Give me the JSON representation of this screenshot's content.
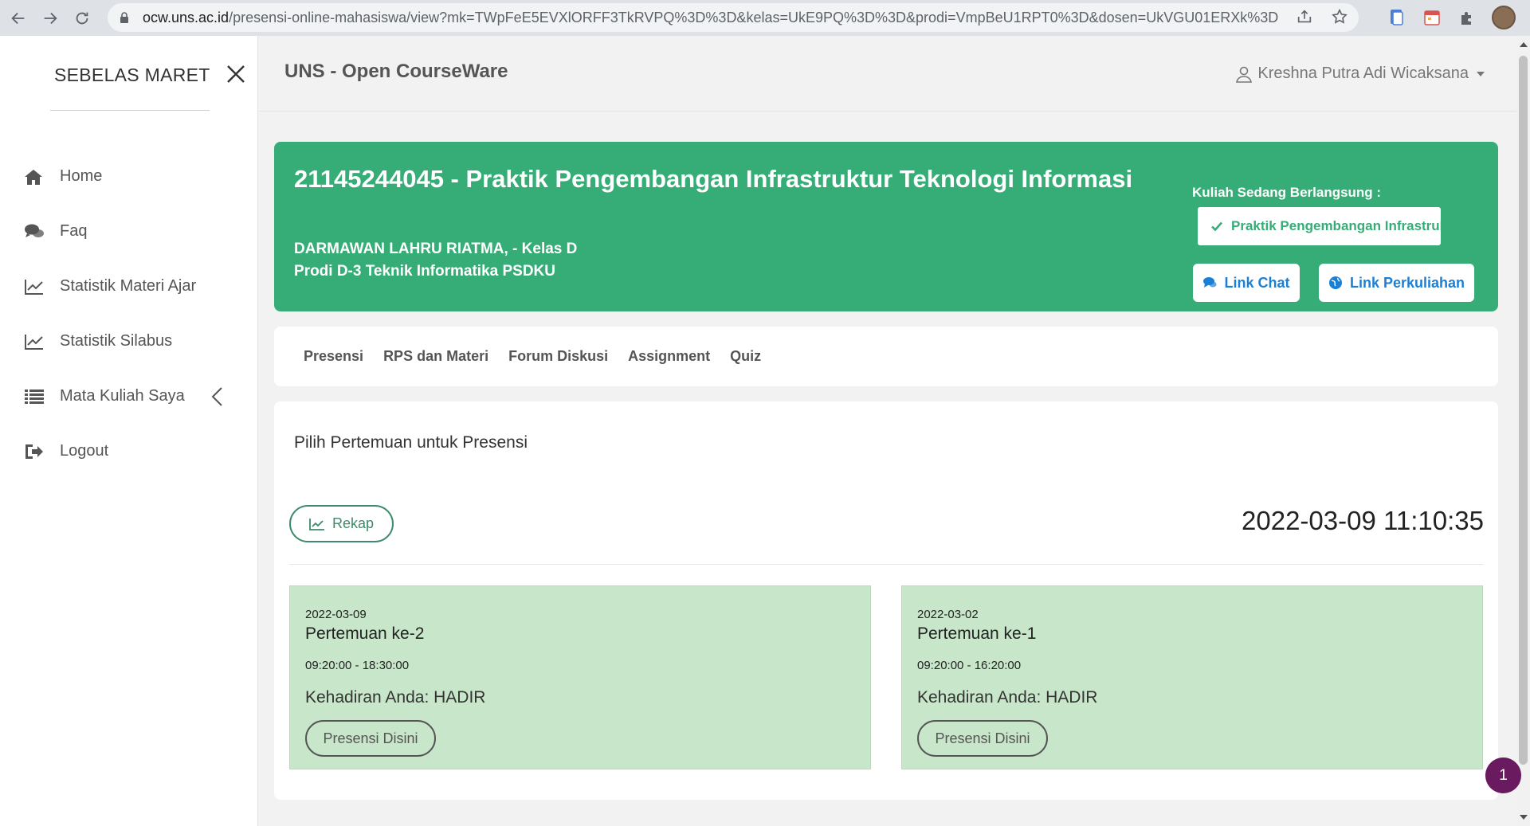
{
  "browser": {
    "url_host": "ocw.uns.ac.id",
    "url_path": "/presensi-online-mahasiswa/view?mk=TWpFeE5EVXlORFF3TkRVPQ%3D%3D&kelas=UkE9PQ%3D%3D&prodi=VmpBeU1RPT0%3D&dosen=UkVGU01ERXk%3D"
  },
  "sidebar": {
    "brand": "SEBELAS MARET",
    "items": [
      {
        "label": "Home",
        "icon": "home-icon"
      },
      {
        "label": "Faq",
        "icon": "chat-bubbles-icon"
      },
      {
        "label": "Statistik Materi Ajar",
        "icon": "line-chart-icon"
      },
      {
        "label": "Statistik Silabus",
        "icon": "line-chart-icon"
      },
      {
        "label": "Mata Kuliah Saya",
        "icon": "list-icon"
      },
      {
        "label": "Logout",
        "icon": "logout-icon"
      }
    ]
  },
  "header": {
    "app_title": "UNS - Open CourseWare",
    "user_name": "Kreshna Putra Adi Wicaksana"
  },
  "course": {
    "title": "21145244045 - Praktik Pengembangan Infrastruktur Teknologi Informasi",
    "lecturer": "DARMAWAN LAHRU RIATMA, - Kelas D",
    "prodi": "Prodi D-3 Teknik Informatika PSDKU",
    "ongoing_label": "Kuliah Sedang Berlangsung :",
    "ongoing_course": "Praktik Pengembangan Infrastruktur Teknologi Informasi",
    "link_chat": "Link Chat",
    "link_kuliah": "Link Perkuliahan"
  },
  "tabs": [
    "Presensi",
    "RPS dan Materi",
    "Forum Diskusi",
    "Assignment",
    "Quiz"
  ],
  "presensi": {
    "title": "Pilih Pertemuan untuk Presensi",
    "rekap_label": "Rekap",
    "clock": "2022-03-09 11:10:35",
    "meetings": [
      {
        "date": "2022-03-09",
        "name": "Pertemuan ke-2",
        "time": "09:20:00 - 18:30:00",
        "status": "Kehadiran Anda: HADIR",
        "button": "Presensi Disini"
      },
      {
        "date": "2022-03-02",
        "name": "Pertemuan ke-1",
        "time": "09:20:00 - 16:20:00",
        "status": "Kehadiran Anda: HADIR",
        "button": "Presensi Disini"
      }
    ]
  },
  "notification_count": "1",
  "colors": {
    "accent_green": "#36ad76",
    "card_green": "#c8e6c9",
    "link_blue": "#1a7fd6",
    "badge_purple": "#6a1a5f"
  }
}
